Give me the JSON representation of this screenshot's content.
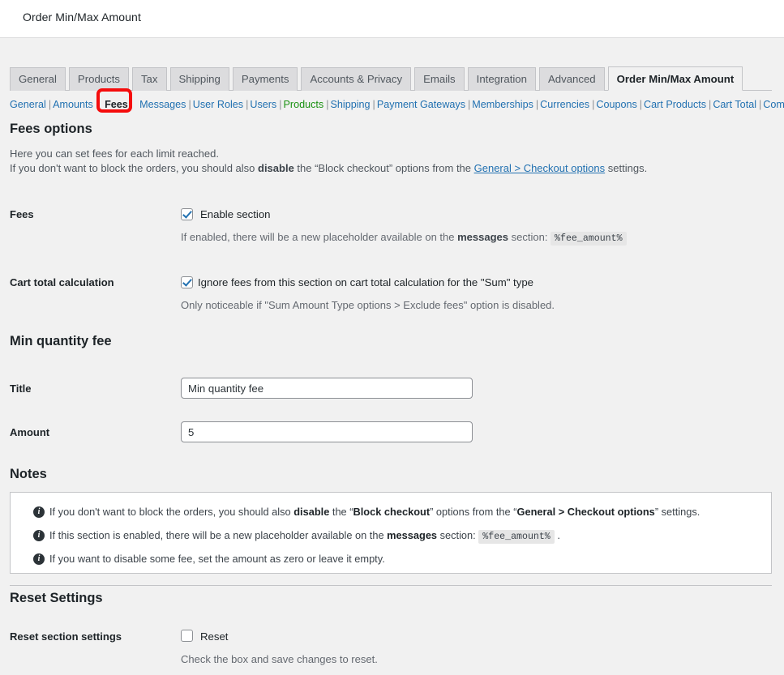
{
  "window": {
    "title": "Order Min/Max Amount"
  },
  "nav_tabs": [
    {
      "label": "General",
      "active": false
    },
    {
      "label": "Products",
      "active": false
    },
    {
      "label": "Tax",
      "active": false
    },
    {
      "label": "Shipping",
      "active": false
    },
    {
      "label": "Payments",
      "active": false
    },
    {
      "label": "Accounts & Privacy",
      "active": false
    },
    {
      "label": "Emails",
      "active": false
    },
    {
      "label": "Integration",
      "active": false
    },
    {
      "label": "Advanced",
      "active": false
    },
    {
      "label": "Order Min/Max Amount",
      "active": true
    }
  ],
  "subnav": {
    "items": [
      {
        "label": "General",
        "style": "link"
      },
      {
        "label": "Amounts",
        "style": "link"
      },
      {
        "label": "Fees",
        "style": "current"
      },
      {
        "label": "Messages",
        "style": "link"
      },
      {
        "label": "User Roles",
        "style": "link"
      },
      {
        "label": "Users",
        "style": "link"
      },
      {
        "label": "Products",
        "style": "green"
      },
      {
        "label": "Shipping",
        "style": "link"
      },
      {
        "label": "Payment Gateways",
        "style": "link"
      },
      {
        "label": "Memberships",
        "style": "link"
      },
      {
        "label": "Currencies",
        "style": "link"
      },
      {
        "label": "Coupons",
        "style": "link"
      },
      {
        "label": "Cart Products",
        "style": "link"
      },
      {
        "label": "Cart Total",
        "style": "link"
      }
    ],
    "last_item": {
      "label": "Compatibility",
      "style": "link"
    },
    "separator": "|",
    "highlight_color": "#f50c0c"
  },
  "fees_options": {
    "heading": "Fees options",
    "desc_line1": "Here you can set fees for each limit reached.",
    "desc_line2_a": "If you don't want to block the orders, you should also ",
    "desc_line2_bold": "disable",
    "desc_line2_b": " the “Block checkout” options from the ",
    "desc_line2_link": "General > Checkout options",
    "desc_line2_c": " settings."
  },
  "fees_row": {
    "label": "Fees",
    "checkbox_label": "Enable section",
    "checked": true,
    "helper_a": "If enabled, there will be a new placeholder available on the ",
    "helper_bold": "messages",
    "helper_b": " section: ",
    "helper_code": "%fee_amount%"
  },
  "cart_total_row": {
    "label": "Cart total calculation",
    "checkbox_label": "Ignore fees from this section on cart total calculation for the \"Sum\" type",
    "checked": true,
    "helper": "Only noticeable if \"Sum Amount Type options > Exclude fees\" option is disabled."
  },
  "min_quantity_fee": {
    "heading": "Min quantity fee",
    "title_label": "Title",
    "title_value": "Min quantity fee",
    "amount_label": "Amount",
    "amount_value": "5"
  },
  "notes": {
    "heading": "Notes",
    "items": [
      {
        "icon": "info-icon",
        "a": "If you don't want to block the orders, you should also ",
        "bold1": "disable",
        "b": " the “",
        "bold2": "Block checkout",
        "c": "” options from the “",
        "bold3": "General > Checkout options",
        "d": "” settings.",
        "code": ""
      },
      {
        "icon": "info-icon",
        "a": "If this section is enabled, there will be a new placeholder available on the ",
        "bold1": "messages",
        "b": " section: ",
        "bold2": "",
        "c": "",
        "bold3": "",
        "d": " .",
        "code": "%fee_amount%"
      },
      {
        "icon": "info-icon",
        "a": "If you want to disable some fee, set the amount as zero or leave it empty.",
        "bold1": "",
        "b": "",
        "bold2": "",
        "c": "",
        "bold3": "",
        "d": "",
        "code": ""
      }
    ]
  },
  "reset_settings": {
    "heading": "Reset Settings",
    "row_label": "Reset section settings",
    "checkbox_label": "Reset",
    "checked": false,
    "helper": "Check the box and save changes to reset."
  }
}
